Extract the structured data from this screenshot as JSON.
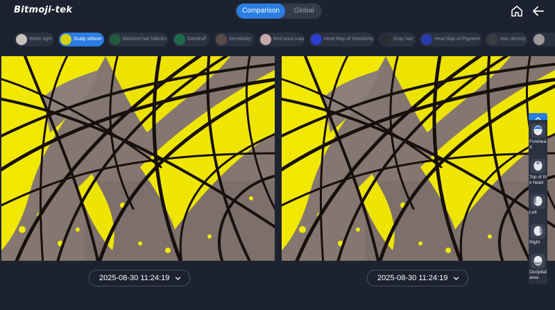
{
  "app": {
    "logo": "Bitmoji-tek"
  },
  "header": {
    "tabs": [
      {
        "label": "Comparison",
        "active": true
      },
      {
        "label": "Global",
        "active": false
      }
    ],
    "home_icon": "home-icon",
    "back_icon": "arrow-left-icon"
  },
  "filters": [
    {
      "label": "White light",
      "active": false
    },
    {
      "label": "Scalp sebum",
      "active": true
    },
    {
      "label": "Blocked hair follicles",
      "active": false
    },
    {
      "label": "Dandruff",
      "active": false
    },
    {
      "label": "Sensitivity",
      "active": false
    },
    {
      "label": "Red area map",
      "active": false
    },
    {
      "label": "Heat Map of Sensitivity",
      "active": false
    },
    {
      "label": "Gray hair",
      "active": false
    },
    {
      "label": "Heat Map of Pigment",
      "active": false
    },
    {
      "label": "Hair density",
      "active": false
    }
  ],
  "comparison": {
    "left": {
      "date": "2025-08-30 11:24:19"
    },
    "right": {
      "date": "2025-08-30 11:24:19"
    }
  },
  "regions": {
    "items": [
      {
        "label": "Forehead",
        "active": true
      },
      {
        "label": "Top of the head",
        "active": false
      },
      {
        "label": "Left",
        "active": false
      },
      {
        "label": "Right",
        "active": false
      },
      {
        "label": "Occipital area",
        "active": false
      }
    ]
  },
  "colors": {
    "accent": "#2a7de1",
    "background": "#1d2230",
    "sebum_highlight": "#f2ea00"
  }
}
